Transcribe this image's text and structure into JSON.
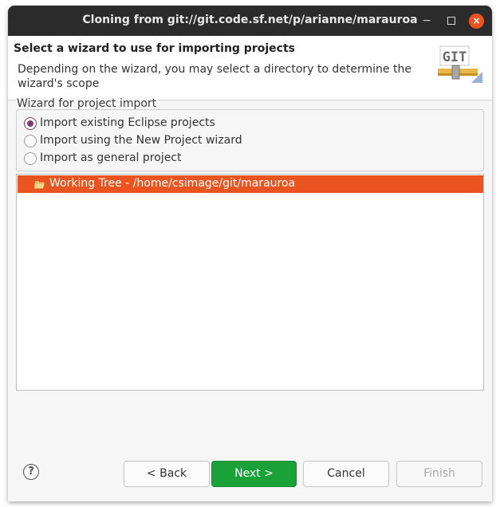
{
  "window": {
    "title": "Cloning from git://git.code.sf.net/p/arianne/marauroa",
    "minimize_glyph": "−",
    "close_glyph": "×"
  },
  "header": {
    "title": "Select a wizard to use for importing projects",
    "description": "Depending on the wizard, you may select a directory to determine the wizard's scope",
    "logo_text": "GIT"
  },
  "wizard_group": {
    "label": "Wizard for project import",
    "options": [
      {
        "label": "Import existing Eclipse projects",
        "checked": true
      },
      {
        "label": "Import using the New Project wizard",
        "checked": false
      },
      {
        "label": "Import as general project",
        "checked": false
      }
    ]
  },
  "tree": {
    "items": [
      {
        "label": "Working Tree - /home/csimage/git/marauroa",
        "icon": "folder-open-icon",
        "selected": true
      }
    ]
  },
  "buttons": {
    "help": "?",
    "back": "< Back",
    "next": "Next >",
    "cancel": "Cancel",
    "finish": "Finish"
  },
  "colors": {
    "accent_orange": "#e95420",
    "next_green": "#1aa238",
    "radio_purple": "#7c3e6a",
    "titlebar": "#2b2b2b"
  }
}
